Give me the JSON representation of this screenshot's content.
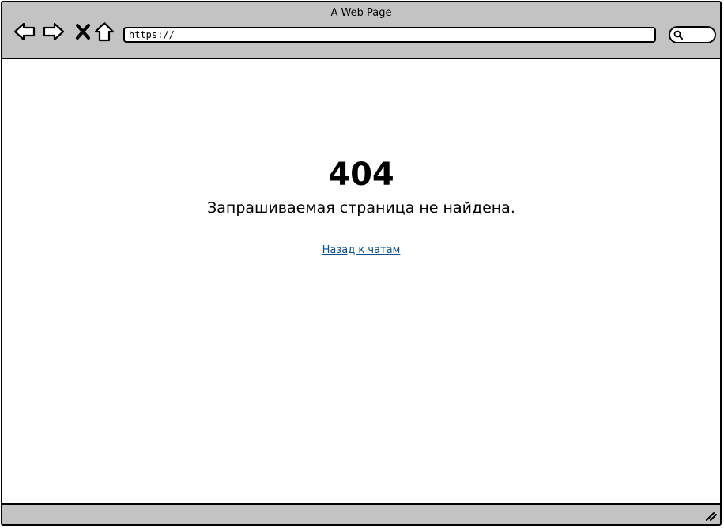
{
  "browser": {
    "window_title": "A Web Page",
    "url": "https://",
    "nav_icons": [
      "back-arrow-icon",
      "forward-arrow-icon",
      "close-x-icon",
      "home-icon"
    ],
    "search_icon": "search-icon"
  },
  "page": {
    "error_code": "404",
    "error_message": "Запрашиваемая страница не найдена.",
    "back_link_label": "Назад к чатам",
    "link_color": "#0b4e88"
  },
  "colors": {
    "chrome_bg": "#c3c3c3",
    "content_bg": "#ffffff",
    "border": "#000000"
  }
}
